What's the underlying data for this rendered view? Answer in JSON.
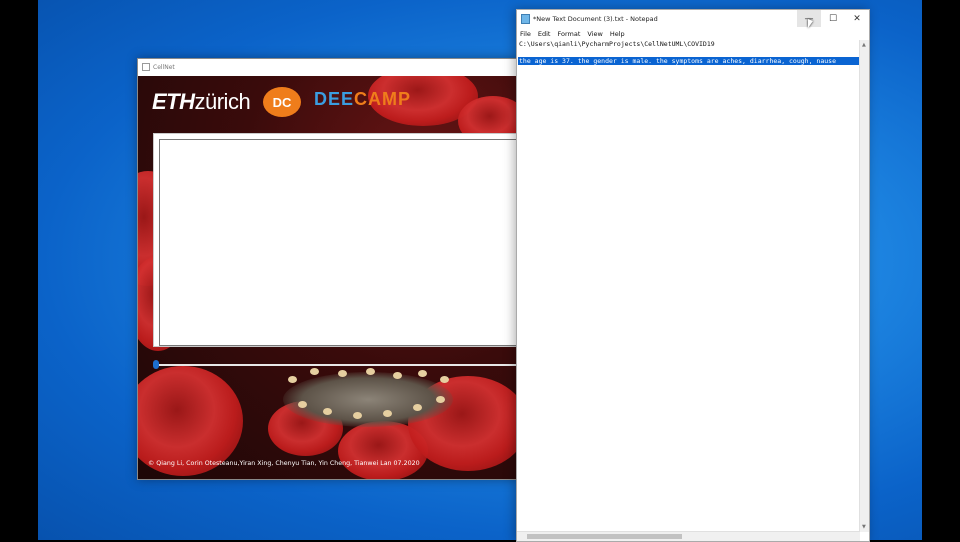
{
  "cellnet": {
    "title": "CellNet",
    "logo_eth": "ETH",
    "logo_zurich": "zürich",
    "logo_dc": "DC",
    "logo_dee": "DEE",
    "logo_camp": "CAMP",
    "credit": "© Qiang Li, Corin Otesteanu,Yiran Xing, Chenyu Tian, Yin Cheng, Tianwei Lan 07.2020",
    "slider_value": 0
  },
  "notepad": {
    "title": "*New Text Document (3).txt - Notepad",
    "menu": [
      "File",
      "Edit",
      "Format",
      "View",
      "Help"
    ],
    "line1": "C:\\Users\\qianli\\PycharmProjects\\CellNetUML\\COVID19",
    "line3": "the age is 37. the gender is male. the symptoms are aches, diarrhea, cough, nause",
    "minimize": "—",
    "maximize": "☐",
    "close": "✕"
  },
  "colors": {
    "desktop": "#1e86e2",
    "selection": "#0a64d2",
    "accent_orange": "#ef7d1b",
    "accent_blue": "#3b9de0"
  }
}
